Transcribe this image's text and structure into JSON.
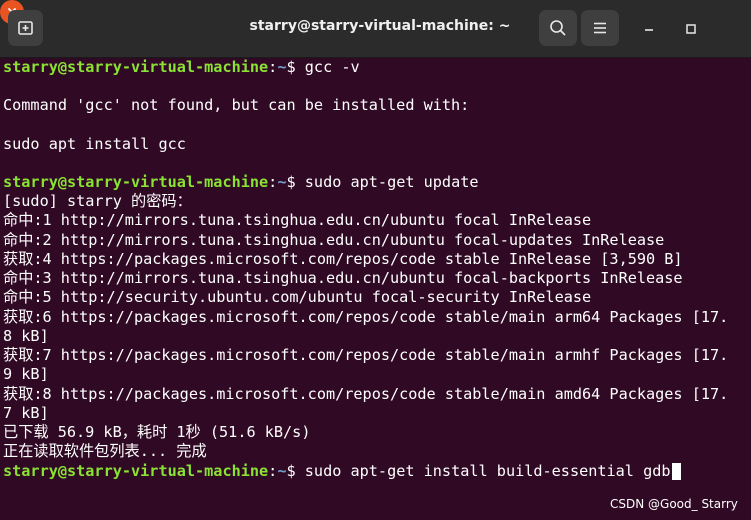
{
  "window": {
    "title": "starry@starry-virtual-machine: ~",
    "icons": {
      "new_tab": "new-tab-icon",
      "search": "search-icon",
      "menu": "hamburger-menu-icon",
      "minimize": "minimize-icon",
      "maximize": "maximize-icon",
      "close": "close-icon"
    }
  },
  "colors": {
    "titlebar": "#2b2b2b",
    "terminal_bg": "#300a24",
    "prompt_user": "#8ae234",
    "prompt_path": "#729fcf",
    "close_button": "#e95420",
    "text": "#ffffff"
  },
  "prompt": {
    "user_host": "starry@starry-virtual-machine",
    "sep": ":",
    "path": "~",
    "symbol": "$ "
  },
  "terminal": {
    "cmd1": "gcc -v",
    "out1": "Command 'gcc' not found, but can be installed with:",
    "out2": "sudo apt install gcc",
    "cmd2": "sudo apt-get update",
    "sudo_prompt": "[sudo] starry 的密码：",
    "apt_lines": [
      "命中:1 http://mirrors.tuna.tsinghua.edu.cn/ubuntu focal InRelease",
      "命中:2 http://mirrors.tuna.tsinghua.edu.cn/ubuntu focal-updates InRelease",
      "获取:4 https://packages.microsoft.com/repos/code stable InRelease [3,590 B]",
      "命中:3 http://mirrors.tuna.tsinghua.edu.cn/ubuntu focal-backports InRelease",
      "命中:5 http://security.ubuntu.com/ubuntu focal-security InRelease",
      "获取:6 https://packages.microsoft.com/repos/code stable/main arm64 Packages [17.",
      "8 kB]",
      "获取:7 https://packages.microsoft.com/repos/code stable/main armhf Packages [17.",
      "9 kB]",
      "获取:8 https://packages.microsoft.com/repos/code stable/main amd64 Packages [17.",
      "7 kB]",
      "已下载 56.9 kB，耗时 1秒 (51.6 kB/s)",
      "正在读取软件包列表... 完成"
    ],
    "cmd3": "sudo apt-get install build-essential gdb"
  },
  "watermark": "CSDN @Good_ Starry"
}
